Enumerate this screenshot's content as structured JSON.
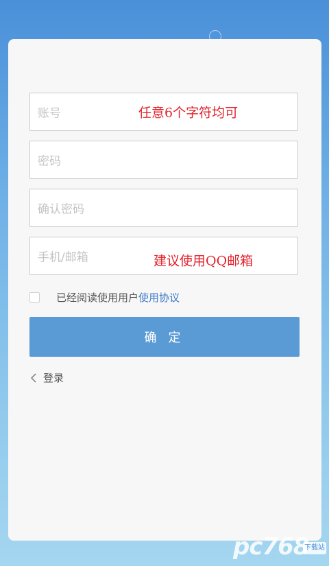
{
  "form": {
    "account": {
      "placeholder": "账号",
      "note": "任意6个字符均可"
    },
    "password": {
      "placeholder": "密码"
    },
    "confirm_password": {
      "placeholder": "确认密码"
    },
    "contact": {
      "placeholder": "手机/邮箱",
      "note": "建议使用QQ邮箱"
    }
  },
  "agreement": {
    "text": "已经阅读使用用户",
    "link": "使用协议"
  },
  "confirm_button": "确 定",
  "login_link": "登录",
  "watermark": {
    "main": "pc768",
    "sub": "下载站"
  },
  "colors": {
    "accent": "#5b9bd5",
    "link": "#3b78c6",
    "note": "#e3222b"
  }
}
